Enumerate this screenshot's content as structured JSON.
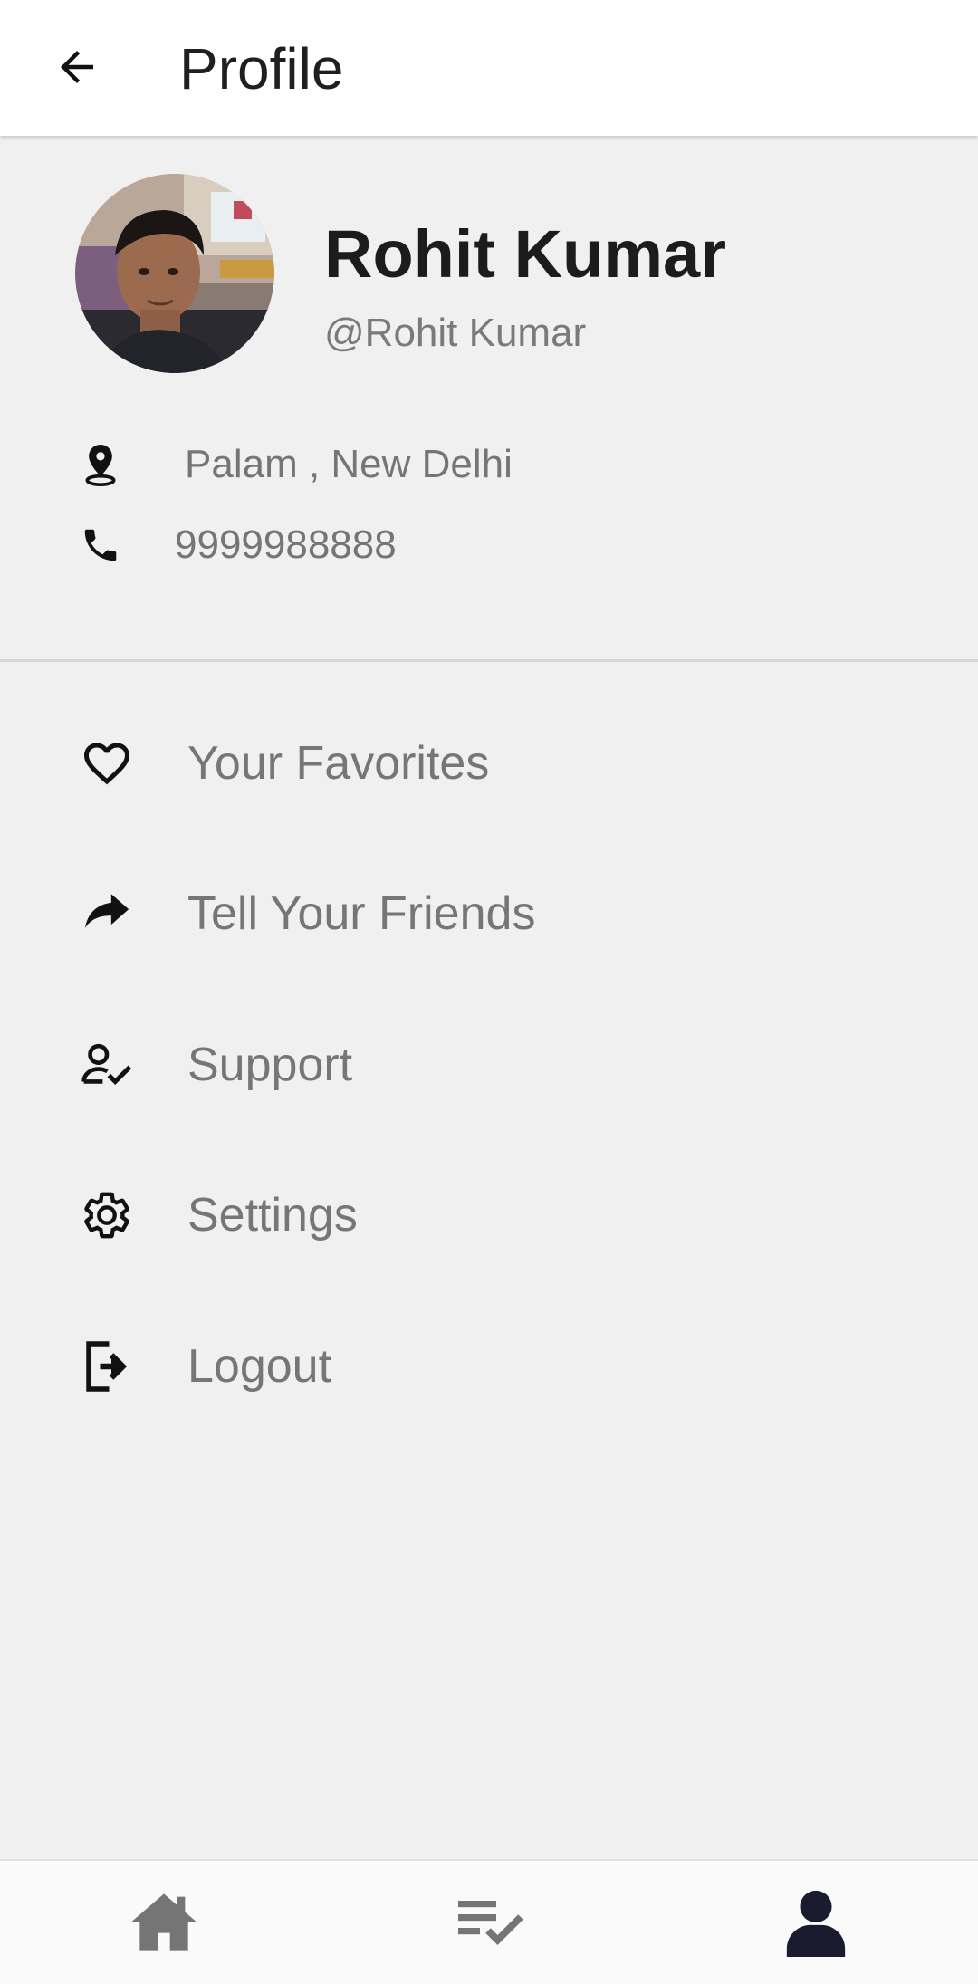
{
  "header": {
    "title": "Profile",
    "back_icon": "arrow-left-icon"
  },
  "profile": {
    "name": "Rohit Kumar",
    "handle": "@Rohit Kumar",
    "avatar_icon": "user-photo"
  },
  "details": {
    "location": "Palam , New Delhi",
    "location_icon": "map-pin-icon",
    "phone": "9999988888",
    "phone_icon": "phone-icon"
  },
  "menu": [
    {
      "label": "Your Favorites",
      "icon": "heart-icon"
    },
    {
      "label": "Tell Your Friends",
      "icon": "share-icon"
    },
    {
      "label": "Support",
      "icon": "user-check-icon"
    },
    {
      "label": "Settings",
      "icon": "gear-icon"
    },
    {
      "label": "Logout",
      "icon": "logout-icon"
    }
  ],
  "bottom_nav": [
    {
      "icon": "home-icon",
      "active": false
    },
    {
      "icon": "list-check-icon",
      "active": false
    },
    {
      "icon": "person-icon",
      "active": true
    }
  ],
  "colors": {
    "background": "#f0f0f0",
    "header_bg": "#ffffff",
    "title_text": "#1f1f1f",
    "muted_text": "#767676",
    "nav_inactive": "#757575",
    "nav_active": "#1b1b2f"
  }
}
